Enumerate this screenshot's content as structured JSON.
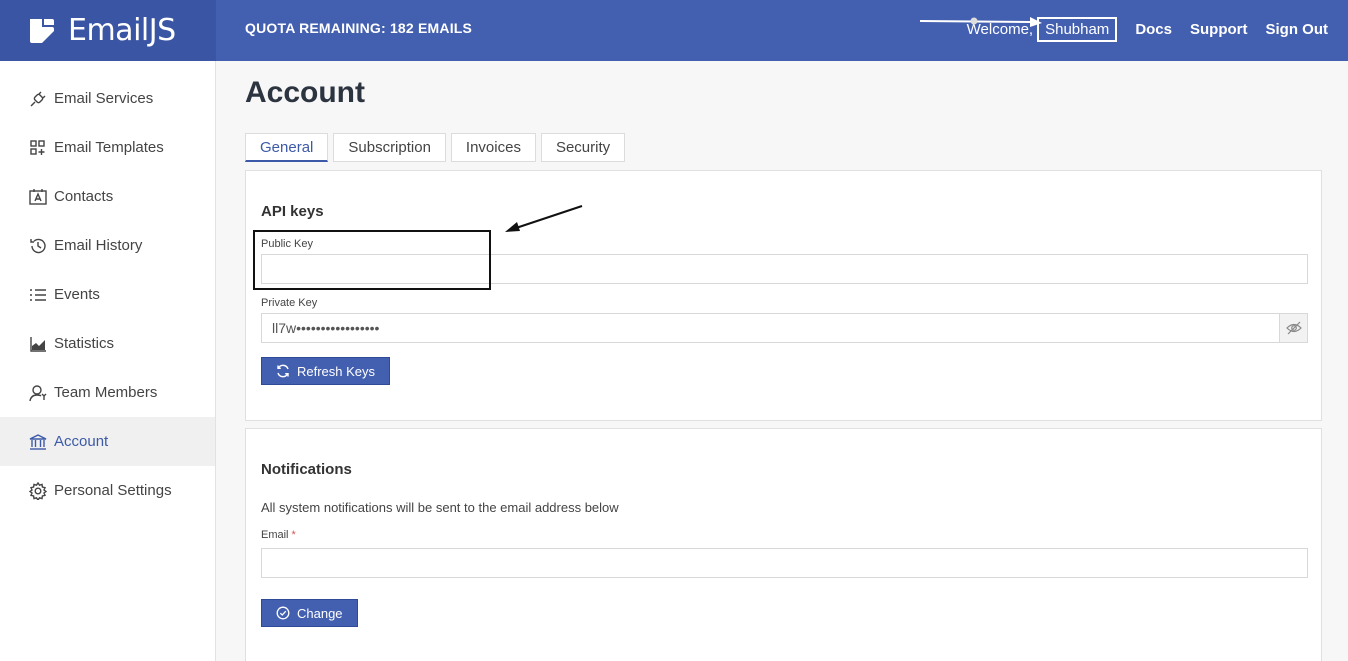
{
  "brand": {
    "name": "EmailJS"
  },
  "header": {
    "quota": "QUOTA REMAINING: 182 EMAILS",
    "welcome": "Welcome,",
    "user": "Shubham",
    "links": [
      "Docs",
      "Support",
      "Sign Out"
    ]
  },
  "sidebar": {
    "items": [
      {
        "label": "Email Services",
        "icon": "plug-icon"
      },
      {
        "label": "Email Templates",
        "icon": "templates-icon"
      },
      {
        "label": "Contacts",
        "icon": "contacts-icon"
      },
      {
        "label": "Email History",
        "icon": "history-icon"
      },
      {
        "label": "Events",
        "icon": "list-icon"
      },
      {
        "label": "Statistics",
        "icon": "chart-icon"
      },
      {
        "label": "Team Members",
        "icon": "team-icon"
      },
      {
        "label": "Account",
        "icon": "bank-icon",
        "active": true
      },
      {
        "label": "Personal Settings",
        "icon": "gear-icon"
      }
    ]
  },
  "page": {
    "title": "Account",
    "tabs": [
      "General",
      "Subscription",
      "Invoices",
      "Security"
    ],
    "active_tab": "General"
  },
  "api_keys": {
    "title": "API keys",
    "public_label": "Public Key",
    "public_value": "",
    "private_label": "Private Key",
    "private_value": "ll7w•••••••••••••••••",
    "refresh_label": "Refresh Keys"
  },
  "notifications": {
    "title": "Notifications",
    "description": "All system notifications will be sent to the email address below",
    "email_label": "Email",
    "required_mark": "*",
    "email_value": "",
    "change_label": "Change"
  },
  "colors": {
    "header": "#435fb0",
    "brand_bg": "#3a55a4",
    "accent": "#3d5aa8"
  }
}
